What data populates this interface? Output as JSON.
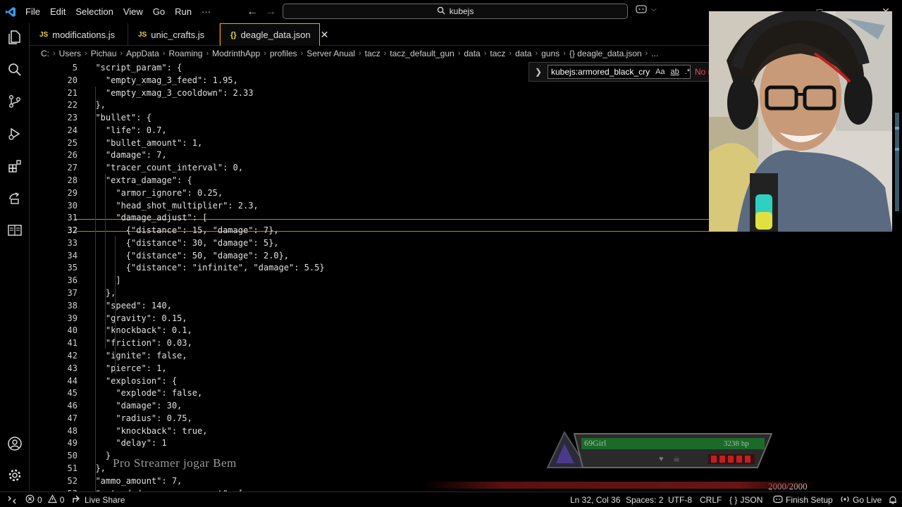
{
  "menu": {
    "file": "File",
    "edit": "Edit",
    "selection": "Selection",
    "view": "View",
    "go": "Go",
    "run": "Run",
    "more": "···"
  },
  "command_center": {
    "text": "kubejs"
  },
  "tabs": [
    {
      "icon": "JS",
      "label": "modifications.js"
    },
    {
      "icon": "JS",
      "label": "unic_crafts.js"
    },
    {
      "icon": "{}",
      "label": "deagle_data.json"
    }
  ],
  "breadcrumb": [
    "C:",
    "Users",
    "Pichau",
    "AppData",
    "Roaming",
    "ModrinthApp",
    "profiles",
    "Server Anual",
    "tacz",
    "tacz_default_gun",
    "data",
    "tacz",
    "data",
    "guns",
    "{} deagle_data.json",
    "..."
  ],
  "find_widget": {
    "query": "kubejs:armored_black_cry",
    "opt_case": "Aa",
    "opt_word": "ab",
    "opt_regex": ".*",
    "no_results": "No r"
  },
  "code_lines": [
    {
      "num": "5",
      "text": "  \"script_param\": {"
    },
    {
      "num": "20",
      "text": "    \"empty_xmag_3_feed\": 1.95,"
    },
    {
      "num": "21",
      "text": "    \"empty_xmag_3_cooldown\": 2.33"
    },
    {
      "num": "22",
      "text": "  },"
    },
    {
      "num": "23",
      "text": "  \"bullet\": {"
    },
    {
      "num": "24",
      "text": "    \"life\": 0.7,"
    },
    {
      "num": "25",
      "text": "    \"bullet_amount\": 1,"
    },
    {
      "num": "26",
      "text": "    \"damage\": 7,"
    },
    {
      "num": "27",
      "text": "    \"tracer_count_interval\": 0,"
    },
    {
      "num": "28",
      "text": "    \"extra_damage\": {"
    },
    {
      "num": "29",
      "text": "      \"armor_ignore\": 0.25,"
    },
    {
      "num": "30",
      "text": "      \"head_shot_multiplier\": 2.3,"
    },
    {
      "num": "31",
      "text": "      \"damage_adjust\": ["
    },
    {
      "num": "32",
      "text": "        {\"distance\": 15, \"damage\": 7},"
    },
    {
      "num": "33",
      "text": "        {\"distance\": 30, \"damage\": 5},"
    },
    {
      "num": "34",
      "text": "        {\"distance\": 50, \"damage\": 2.0},"
    },
    {
      "num": "35",
      "text": "        {\"distance\": \"infinite\", \"damage\": 5.5}"
    },
    {
      "num": "36",
      "text": "      ]"
    },
    {
      "num": "37",
      "text": "    },"
    },
    {
      "num": "38",
      "text": "    \"speed\": 140,"
    },
    {
      "num": "39",
      "text": "    \"gravity\": 0.15,"
    },
    {
      "num": "40",
      "text": "    \"knockback\": 0.1,"
    },
    {
      "num": "41",
      "text": "    \"friction\": 0.03,"
    },
    {
      "num": "42",
      "text": "    \"ignite\": false,"
    },
    {
      "num": "43",
      "text": "    \"pierce\": 1,"
    },
    {
      "num": "44",
      "text": "    \"explosion\": {"
    },
    {
      "num": "45",
      "text": "      \"explode\": false,"
    },
    {
      "num": "46",
      "text": "      \"damage\": 30,"
    },
    {
      "num": "47",
      "text": "      \"radius\": 0.75,"
    },
    {
      "num": "48",
      "text": "      \"knockback\": true,"
    },
    {
      "num": "49",
      "text": "      \"delay\": 1"
    },
    {
      "num": "50",
      "text": "    }"
    },
    {
      "num": "51",
      "text": "  },"
    },
    {
      "num": "52",
      "text": "  \"ammo_amount\": 7,"
    },
    {
      "num": "53",
      "text": "  \"extended_mag_ammo_amount\": ["
    }
  ],
  "current_line": "32",
  "overlay": {
    "stream_text": "Pro Streamer jogar Bem",
    "player_name": "69Girl",
    "player_hp": "3238 hp",
    "ammo_counter": "2000/2000"
  },
  "status": {
    "errors": "0",
    "warnings": "0",
    "live_share": "Live Share",
    "position": "Ln 32, Col 36",
    "spaces": "Spaces: 2",
    "encoding": "UTF-8",
    "eol": "CRLF",
    "language": "JSON",
    "finish_setup": "Finish Setup",
    "go_live": "Go Live"
  },
  "colors": {
    "accent_orange": "#f0a020",
    "bracket_yellow": "#f0d040",
    "bracket_purple": "#d070d0",
    "bracket_blue": "#40a0ff"
  }
}
